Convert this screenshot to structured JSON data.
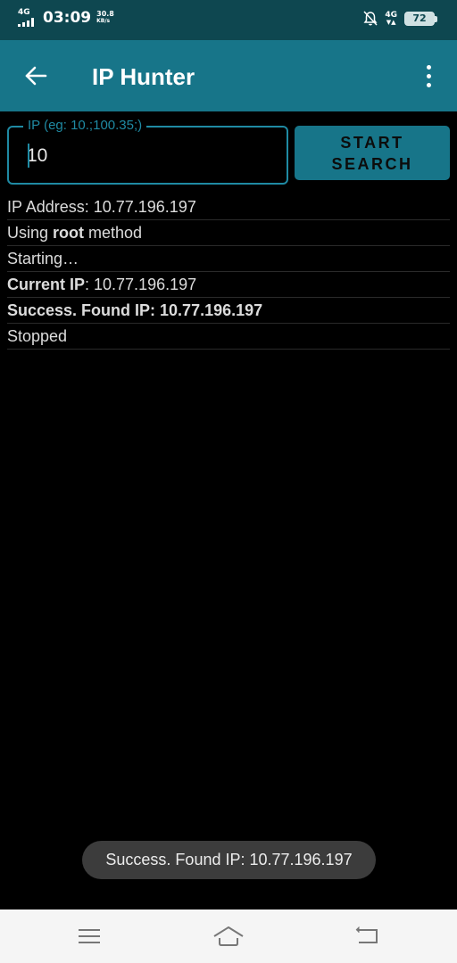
{
  "status_bar": {
    "network_left": "4G",
    "time": "03:09",
    "speed_value": "30.8",
    "speed_unit": "KB/s",
    "network_right": "4G",
    "battery": "72"
  },
  "app_bar": {
    "title": "IP Hunter",
    "back_icon": "arrow-left-icon",
    "menu_icon": "more-vertical-icon"
  },
  "ip_input": {
    "label": "IP (eg: 10.;100.35;)",
    "value": "10"
  },
  "start_button": {
    "label": "START\nSEARCH"
  },
  "log": [
    {
      "prefix": "IP Address: 10.77.196.197",
      "bold": "",
      "suffix": ""
    },
    {
      "prefix": "Using ",
      "bold": "root",
      "suffix": " method"
    },
    {
      "prefix": "Starting…",
      "bold": "",
      "suffix": ""
    },
    {
      "prefix": "",
      "bold": "Current IP",
      "suffix": ": 10.77.196.197"
    },
    {
      "prefix": "",
      "bold": "Success. Found IP: 10.77.196.197",
      "suffix": ""
    },
    {
      "prefix": "Stopped",
      "bold": "",
      "suffix": ""
    }
  ],
  "toast": {
    "text": "Success. Found IP: 10.77.196.197"
  },
  "nav_bar": {
    "menu_icon": "hamburger-icon",
    "home_icon": "home-icon",
    "back_icon": "nav-back-icon"
  },
  "colors": {
    "status_bar": "#0e4750",
    "app_bar": "#177589",
    "accent": "#1f8aa3",
    "background": "#000000",
    "toast": "#3c3c3c"
  }
}
